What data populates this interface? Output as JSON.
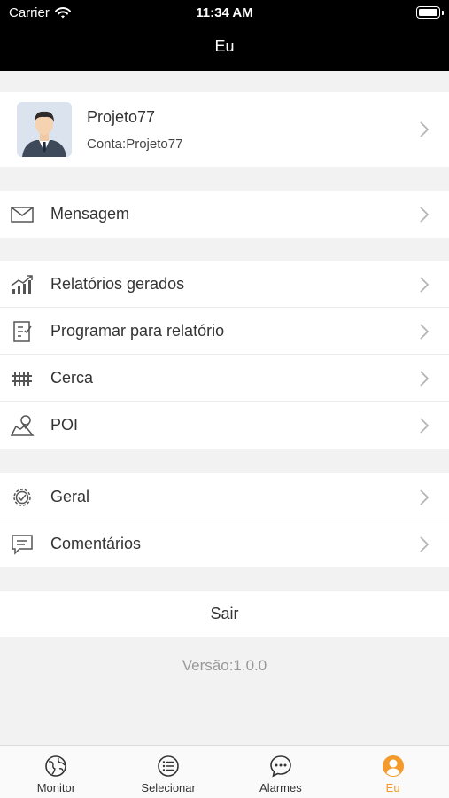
{
  "status_bar": {
    "carrier": "Carrier",
    "time": "11:34 AM"
  },
  "nav": {
    "title": "Eu"
  },
  "profile": {
    "name": "Projeto77",
    "account": "Conta:Projeto77"
  },
  "groups": [
    [
      {
        "label": "Mensagem",
        "icon": "envelope-icon"
      }
    ],
    [
      {
        "label": "Relatórios gerados",
        "icon": "chart-icon"
      },
      {
        "label": "Programar para relatório",
        "icon": "schedule-report-icon"
      },
      {
        "label": "Cerca",
        "icon": "fence-icon"
      },
      {
        "label": "POI",
        "icon": "map-pin-icon"
      }
    ],
    [
      {
        "label": "Geral",
        "icon": "gear-icon"
      },
      {
        "label": "Comentários",
        "icon": "comment-icon"
      }
    ]
  ],
  "logout": {
    "label": "Sair"
  },
  "version": "Versão:1.0.0",
  "tabs": [
    {
      "label": "Monitor",
      "icon": "globe-icon",
      "active": false
    },
    {
      "label": "Selecionar",
      "icon": "list-icon",
      "active": false
    },
    {
      "label": "Alarmes",
      "icon": "chat-icon",
      "active": false
    },
    {
      "label": "Eu",
      "icon": "user-icon",
      "active": true
    }
  ],
  "colors": {
    "accent": "#f39a2b",
    "nav_background": "#000000",
    "page_background": "#f2f2f2"
  }
}
